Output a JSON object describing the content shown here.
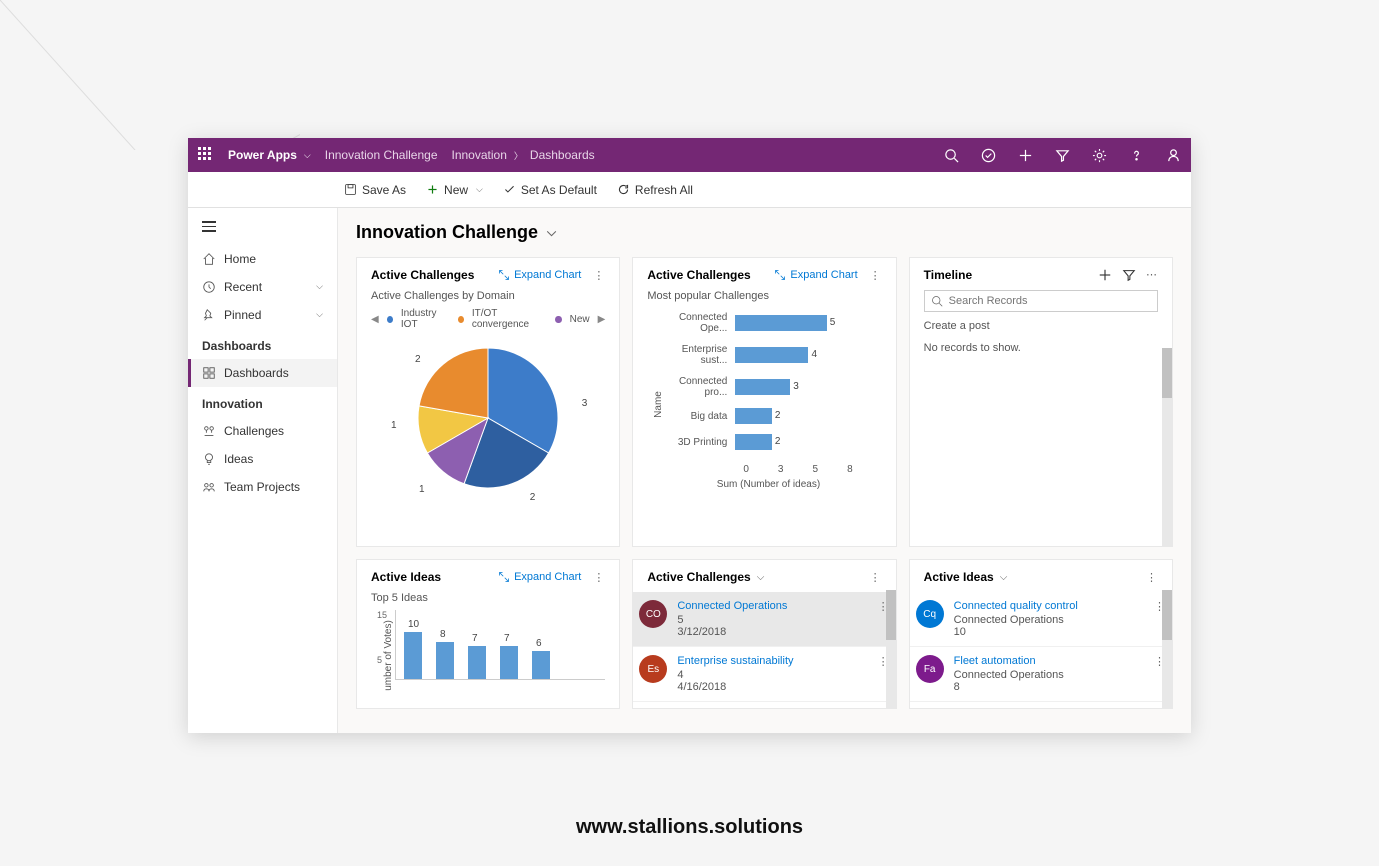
{
  "header": {
    "app_name": "Power Apps",
    "breadcrumb_1": "Innovation Challenge",
    "breadcrumb_2": "Innovation",
    "breadcrumb_3": "Dashboards"
  },
  "commands": {
    "save_as": "Save As",
    "new": "New",
    "set_default": "Set As Default",
    "refresh_all": "Refresh All"
  },
  "sidebar": {
    "home": "Home",
    "recent": "Recent",
    "pinned": "Pinned",
    "section_dash": "Dashboards",
    "dashboards": "Dashboards",
    "section_inno": "Innovation",
    "challenges": "Challenges",
    "ideas": "Ideas",
    "team_projects": "Team Projects"
  },
  "page_title": "Innovation Challenge",
  "cards": {
    "active_challenges_pie": {
      "title": "Active Challenges",
      "expand": "Expand Chart",
      "subtitle": "Active Challenges by Domain",
      "legend": [
        "Industry IOT",
        "IT/OT convergence",
        "New"
      ]
    },
    "active_challenges_bar": {
      "title": "Active Challenges",
      "expand": "Expand Chart",
      "subtitle": "Most popular Challenges",
      "ylabel": "Name",
      "xlabel": "Sum (Number of ideas)"
    },
    "timeline": {
      "title": "Timeline",
      "search_placeholder": "Search Records",
      "create_post": "Create a post",
      "no_records": "No records to show."
    },
    "active_ideas_chart": {
      "title": "Active Ideas",
      "expand": "Expand Chart",
      "subtitle": "Top 5 Ideas",
      "ylabel": "umber of Votes)"
    },
    "active_challenges_list": {
      "title": "Active Challenges",
      "items": [
        {
          "avatar": "CO",
          "color": "#7d2a3a",
          "title": "Connected Operations",
          "count": "5",
          "date": "3/12/2018"
        },
        {
          "avatar": "Es",
          "color": "#b83b1e",
          "title": "Enterprise sustainability",
          "count": "4",
          "date": "4/16/2018"
        }
      ]
    },
    "active_ideas_list": {
      "title": "Active Ideas",
      "items": [
        {
          "avatar": "Cq",
          "color": "#0078d4",
          "title": "Connected quality control",
          "sub": "Connected Operations",
          "count": "10"
        },
        {
          "avatar": "Fa",
          "color": "#7d1b8c",
          "title": "Fleet automation",
          "sub": "Connected Operations",
          "count": "8"
        }
      ]
    }
  },
  "chart_data": [
    {
      "type": "pie",
      "title": "Active Challenges by Domain",
      "series": [
        {
          "name": "Industry IOT",
          "value": 3,
          "color": "#3d7cc9"
        },
        {
          "name": "Industry IOT",
          "value": 2,
          "color": "#2e5fa0"
        },
        {
          "name": "New",
          "value": 1,
          "color": "#8d5fb0"
        },
        {
          "name": "IT/OT convergence",
          "value": 1,
          "color": "#f2c744"
        },
        {
          "name": "IT/OT convergence",
          "value": 2,
          "color": "#e88b2e"
        }
      ]
    },
    {
      "type": "bar",
      "orientation": "horizontal",
      "title": "Most popular Challenges",
      "xlabel": "Sum (Number of ideas)",
      "ylabel": "Name",
      "xlim": [
        0,
        8
      ],
      "categories": [
        "Connected Ope...",
        "Enterprise sust...",
        "Connected pro...",
        "Big data",
        "3D Printing"
      ],
      "values": [
        5,
        4,
        3,
        2,
        2
      ]
    },
    {
      "type": "bar",
      "orientation": "vertical",
      "title": "Top 5 Ideas",
      "ylabel": "(Number of Votes)",
      "ylim": [
        0,
        15
      ],
      "values": [
        10,
        8,
        7,
        7,
        6
      ]
    }
  ],
  "footer_url": "www.stallions.solutions"
}
